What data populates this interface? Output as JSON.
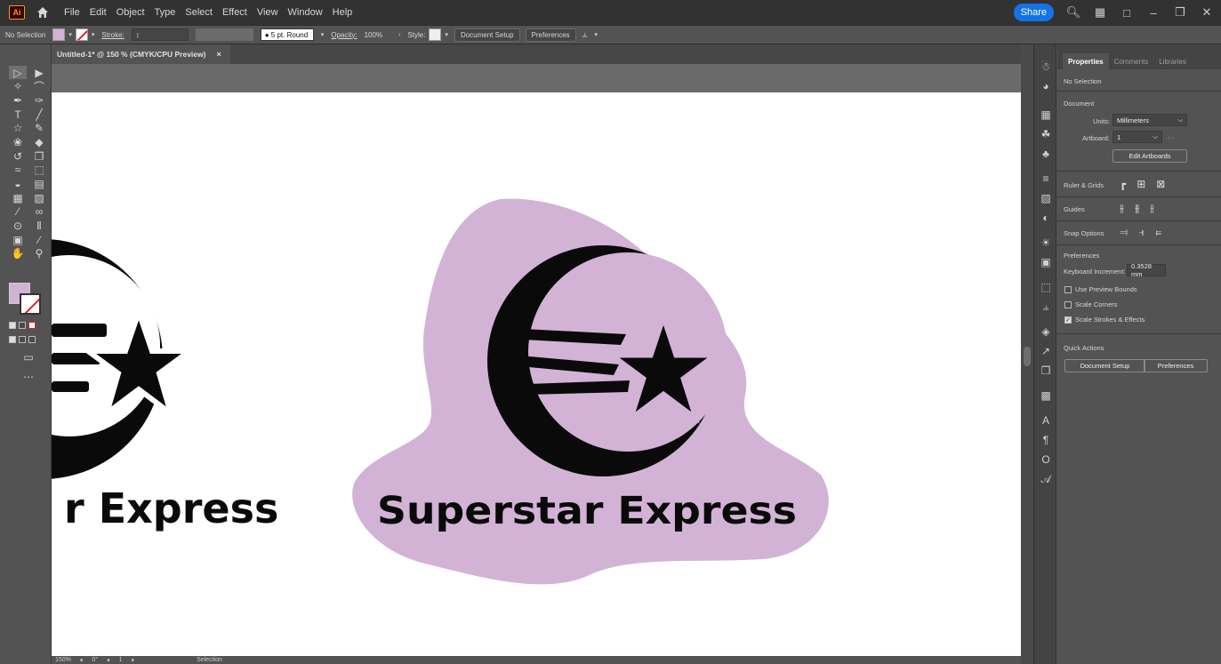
{
  "app": {
    "logo_text": "Ai",
    "share_label": "Share"
  },
  "menus": [
    "File",
    "Edit",
    "Object",
    "Type",
    "Select",
    "Effect",
    "View",
    "Window",
    "Help"
  ],
  "control": {
    "selection": "No Selection",
    "stroke_label": "Stroke:",
    "brush": "5 pt. Round",
    "opacity_label": "Opacity:",
    "opacity_value": "100%",
    "style_label": "Style:",
    "doc_setup": "Document Setup",
    "preferences": "Preferences"
  },
  "document": {
    "tab_title": "Untitled-1* @ 150 % (CMYK/CPU Preview)",
    "close_glyph": "×"
  },
  "artwork": {
    "brand_text": "Superstar Express",
    "left_text": "r Express",
    "blob_color": "#d2b3d6",
    "ink_color": "#0a0a0a"
  },
  "colors": {
    "fill": "#d2b3d6"
  },
  "status": {
    "zoom": "150%",
    "rotate": "0°",
    "artboard": "1",
    "tool": "Selection"
  },
  "panel": {
    "tabs": [
      "Properties",
      "Comments",
      "Libraries"
    ],
    "selection": "No Selection",
    "document_header": "Document",
    "units_label": "Units:",
    "units_value": "Millimeters",
    "artboard_label": "Artboard:",
    "artboard_value": "1",
    "edit_artboards": "Edit Artboards",
    "ruler_grids": "Ruler & Grids",
    "guides": "Guides",
    "snap_options": "Snap Options",
    "preferences_header": "Preferences",
    "keyboard_increment_label": "Keyboard Increment:",
    "keyboard_increment_value": "0.3528 mm",
    "use_preview_bounds": "Use Preview Bounds",
    "scale_corners": "Scale Corners",
    "scale_strokes": "Scale Strokes & Effects",
    "quick_actions": "Quick Actions",
    "doc_setup_btn": "Document Setup",
    "preferences_btn": "Preferences"
  }
}
